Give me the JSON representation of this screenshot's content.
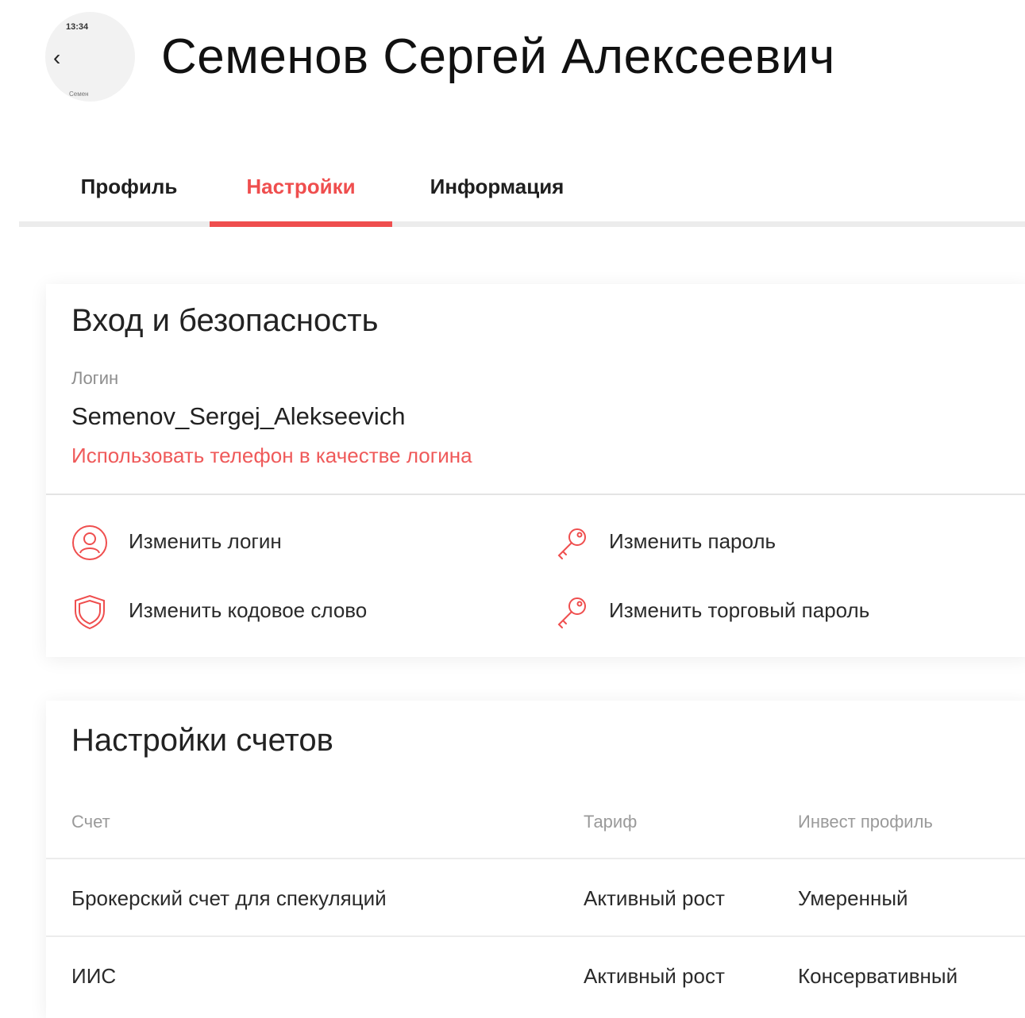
{
  "header": {
    "thumb_time": "13:34",
    "thumb_name": "Семен",
    "title": "Семенов Сергей Алексеевич"
  },
  "tabs": [
    {
      "label": "Профиль",
      "active": false
    },
    {
      "label": "Настройки",
      "active": true
    },
    {
      "label": "Информация",
      "active": false
    }
  ],
  "security": {
    "title": "Вход и безопасность",
    "login_label": "Логин",
    "login_value": "Semenov_Sergej_Alekseevich",
    "phone_link": "Использовать телефон в качестве логина",
    "actions": [
      {
        "label": "Изменить логин",
        "icon": "user-icon"
      },
      {
        "label": "Изменить пароль",
        "icon": "key-icon"
      },
      {
        "label": "Изменить кодовое слово",
        "icon": "shield-icon"
      },
      {
        "label": "Изменить торговый пароль",
        "icon": "key-icon"
      }
    ]
  },
  "accounts": {
    "title": "Настройки счетов",
    "columns": [
      "Счет",
      "Тариф",
      "Инвест профиль"
    ],
    "rows": [
      [
        "Брокерский счет для спекуляций",
        "Активный рост",
        "Умеренный"
      ],
      [
        "ИИС",
        "Активный рост",
        "Консервативный"
      ]
    ]
  },
  "colors": {
    "accent": "#ef4e4e",
    "text": "#1f1f1f",
    "muted": "#9a9a9a",
    "divider": "#e4e4e4"
  }
}
